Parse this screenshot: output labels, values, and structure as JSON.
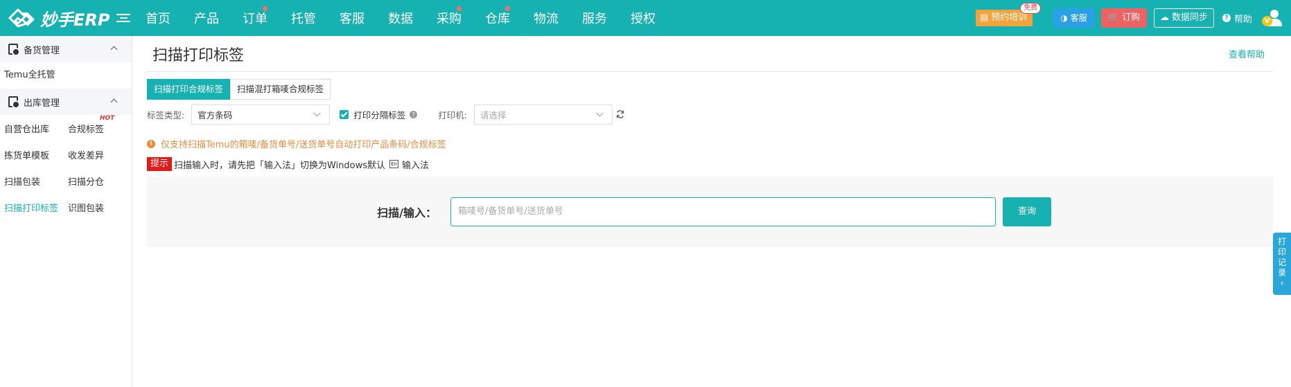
{
  "app": {
    "brand": "妙手ERP"
  },
  "topnav": {
    "items": [
      {
        "label": "首页",
        "dot": false
      },
      {
        "label": "产品",
        "dot": false
      },
      {
        "label": "订单",
        "dot": true
      },
      {
        "label": "托管",
        "dot": false
      },
      {
        "label": "客服",
        "dot": false
      },
      {
        "label": "数据",
        "dot": false
      },
      {
        "label": "采购",
        "dot": true
      },
      {
        "label": "仓库",
        "dot": true
      },
      {
        "label": "物流",
        "dot": false
      },
      {
        "label": "服务",
        "dot": false
      },
      {
        "label": "授权",
        "dot": false
      }
    ],
    "training": "预约培训",
    "training_badge": "免费",
    "service": "客服",
    "order": "订购",
    "sync": "数据同步",
    "help": "帮助",
    "vip": "V"
  },
  "sidebar": {
    "group1": "备货管理",
    "temu": "Temu全托管",
    "group2": "出库管理",
    "rows": [
      [
        "自营仓出库",
        "合规标签"
      ],
      [
        "拣货单模板",
        "收发差异"
      ],
      [
        "扫描包装",
        "扫描分仓"
      ],
      [
        "扫描打印标签",
        "识图包装"
      ]
    ],
    "hot": "HOT"
  },
  "page": {
    "title": "扫描打印标签",
    "help_link": "查看帮助",
    "tabs": [
      "扫描打印合规标签",
      "扫描混打箱唛合规标签"
    ],
    "label_type_label": "标签类型:",
    "label_type_value": "官方条码",
    "print_separator": "打印分隔标签",
    "printer_label": "打印机:",
    "printer_placeholder": "请选择",
    "warning": "仅支持扫描Temu的箱唛/备货单号/送货单号自动打印产品条码/合规标签",
    "tip_badge": "提示",
    "tip_text": "扫描输入时，请先把「输入法」切换为Windows默认",
    "tip_text2": "输入法",
    "tip_en": "En",
    "scan_label": "扫描/输入：",
    "scan_placeholder": "箱唛号/备货单号/送货单号",
    "query_button": "查询"
  },
  "print_record": {
    "chars": [
      "打",
      "印",
      "记",
      "录"
    ]
  },
  "colors": {
    "primary": "#16b1b1",
    "warning": "#f08a3c",
    "danger": "#e81818"
  }
}
